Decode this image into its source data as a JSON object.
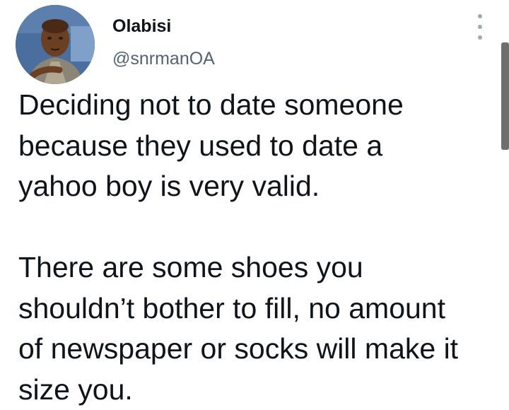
{
  "author": {
    "display_name": "Olabisi",
    "handle": "@snrmanOA",
    "avatar": "profile-photo"
  },
  "more_menu": {
    "icon": "more-vertical-icon"
  },
  "tweet": {
    "paragraphs": [
      "Deciding not to date someone\nbecause they used to date a\nyahoo boy is very valid.",
      "There are some shoes you\nshouldn’t bother to fill, no amount\nof newspaper or socks will make it\nsize you."
    ]
  },
  "colors": {
    "text": "#0f1419",
    "secondary_text": "#536471",
    "background": "#ffffff"
  }
}
